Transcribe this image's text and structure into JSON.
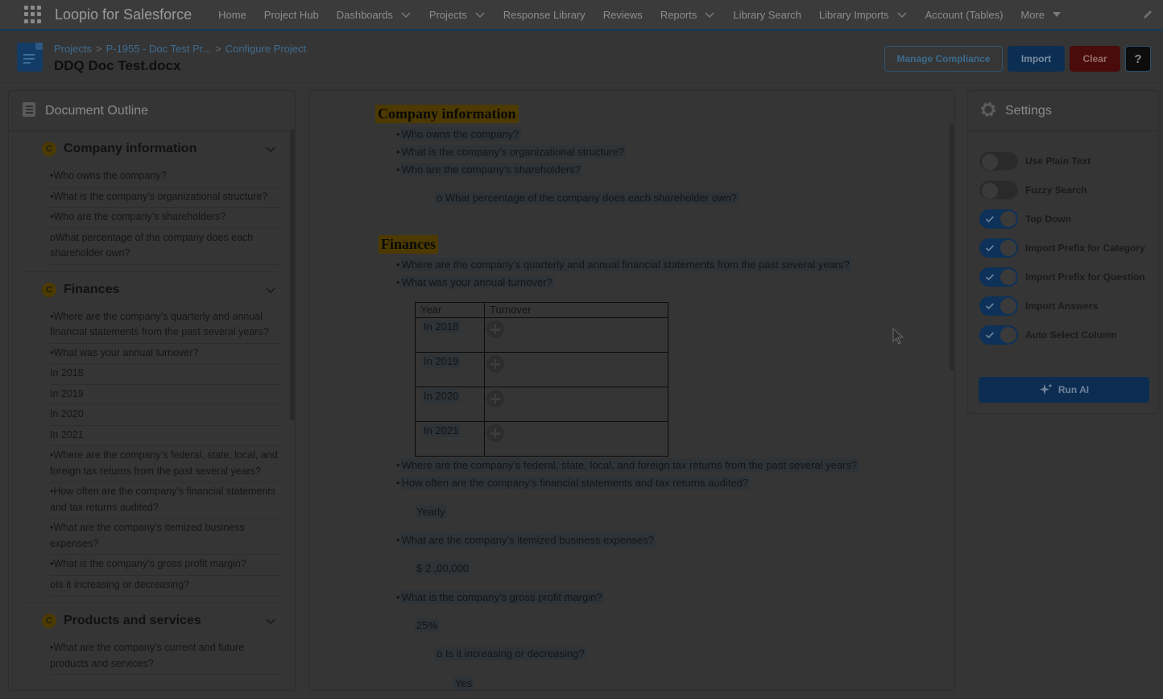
{
  "app": {
    "name": "Loopio for Salesforce"
  },
  "nav": {
    "items": [
      {
        "label": "Home",
        "dropdown": false
      },
      {
        "label": "Project Hub",
        "dropdown": false
      },
      {
        "label": "Dashboards",
        "dropdown": true
      },
      {
        "label": "Projects",
        "dropdown": true
      },
      {
        "label": "Response Library",
        "dropdown": false
      },
      {
        "label": "Reviews",
        "dropdown": false
      },
      {
        "label": "Reports",
        "dropdown": true
      },
      {
        "label": "Library Search",
        "dropdown": false
      },
      {
        "label": "Library Imports",
        "dropdown": true
      },
      {
        "label": "Account (Tables)",
        "dropdown": false
      }
    ],
    "more_label": "More"
  },
  "header": {
    "breadcrumb": [
      "Projects",
      "P-1955 - Doc Test Pr...",
      "Configure Project"
    ],
    "title": "DDQ Doc Test.docx",
    "buttons": {
      "manage_compliance": "Manage Compliance",
      "import": "Import",
      "clear": "Clear",
      "help": "?"
    }
  },
  "outline": {
    "title": "Document Outline",
    "categories": [
      {
        "badge": "C",
        "name": "Company information",
        "items": [
          "•Who owns the company?",
          "•What is the company’s organizational structure?",
          "•Who are the company’s shareholders?",
          "oWhat percentage of the company does each shareholder own?"
        ]
      },
      {
        "badge": "C",
        "name": "Finances",
        "items": [
          "•Where are the company’s quarterly and annual financial statements from the past several years?",
          "•What was your annual turnover?",
          "In 2018",
          "In 2019",
          "In 2020",
          "In 2021",
          "•Where are the company’s federal, state, local, and foreign tax returns from the past several years?",
          "•How often are the company’s financial statements and tax returns audited?",
          "•What are the company’s itemized business expenses?",
          "•What is the company’s gross profit margin?",
          "oIs it increasing or decreasing?"
        ]
      },
      {
        "badge": "C",
        "name": "Products and services",
        "items": [
          "•What are the company’s current and future products and services?"
        ]
      }
    ]
  },
  "document": {
    "sections": [
      {
        "heading": "Company information",
        "questions": [
          "Who owns the company?",
          "What is the company’s organizational structure?",
          "Who are the company’s shareholders?"
        ],
        "sub_question": "What percentage of the company does each shareholder own?"
      },
      {
        "heading": "Finances",
        "questions": [
          "Where are the company’s quarterly and annual financial statements from the past several years?",
          "What was your annual turnover?"
        ],
        "table": {
          "headers": [
            "Year",
            "Turnover"
          ],
          "rows": [
            "In 2018",
            "In 2019",
            "In 2020",
            "In 2021"
          ]
        },
        "questions2": [
          "Where are the company’s federal, state, local, and foreign tax returns from the past several years?",
          "How often are the company’s financial statements and tax returns audited?"
        ],
        "answer_audit": "Yearly",
        "q_expenses": "What are the company’s itemized business expenses?",
        "answer_expenses": "$ 2 ,00,000",
        "q_margin": "What is the company’s gross profit margin?",
        "answer_margin": "25%",
        "sub_margin": "Is it increasing or decreasing?",
        "answer_sub_margin": "Yes"
      }
    ]
  },
  "settings": {
    "title": "Settings",
    "toggles": [
      {
        "label": "Use Plain Text",
        "on": false
      },
      {
        "label": "Fuzzy Search",
        "on": false
      },
      {
        "label": "Top Down",
        "on": true
      },
      {
        "label": "Import Prefix for Category",
        "on": true
      },
      {
        "label": "Import Prefix for Question",
        "on": true
      },
      {
        "label": "Import Answers",
        "on": true
      },
      {
        "label": "Auto Select Column",
        "on": true
      }
    ],
    "run_ai": "Run AI"
  },
  "colors": {
    "accent": "#0c2e52",
    "category_badge": "#4d3a00",
    "highlight": "#2e3338",
    "clear_button": "#4a0b0b"
  }
}
